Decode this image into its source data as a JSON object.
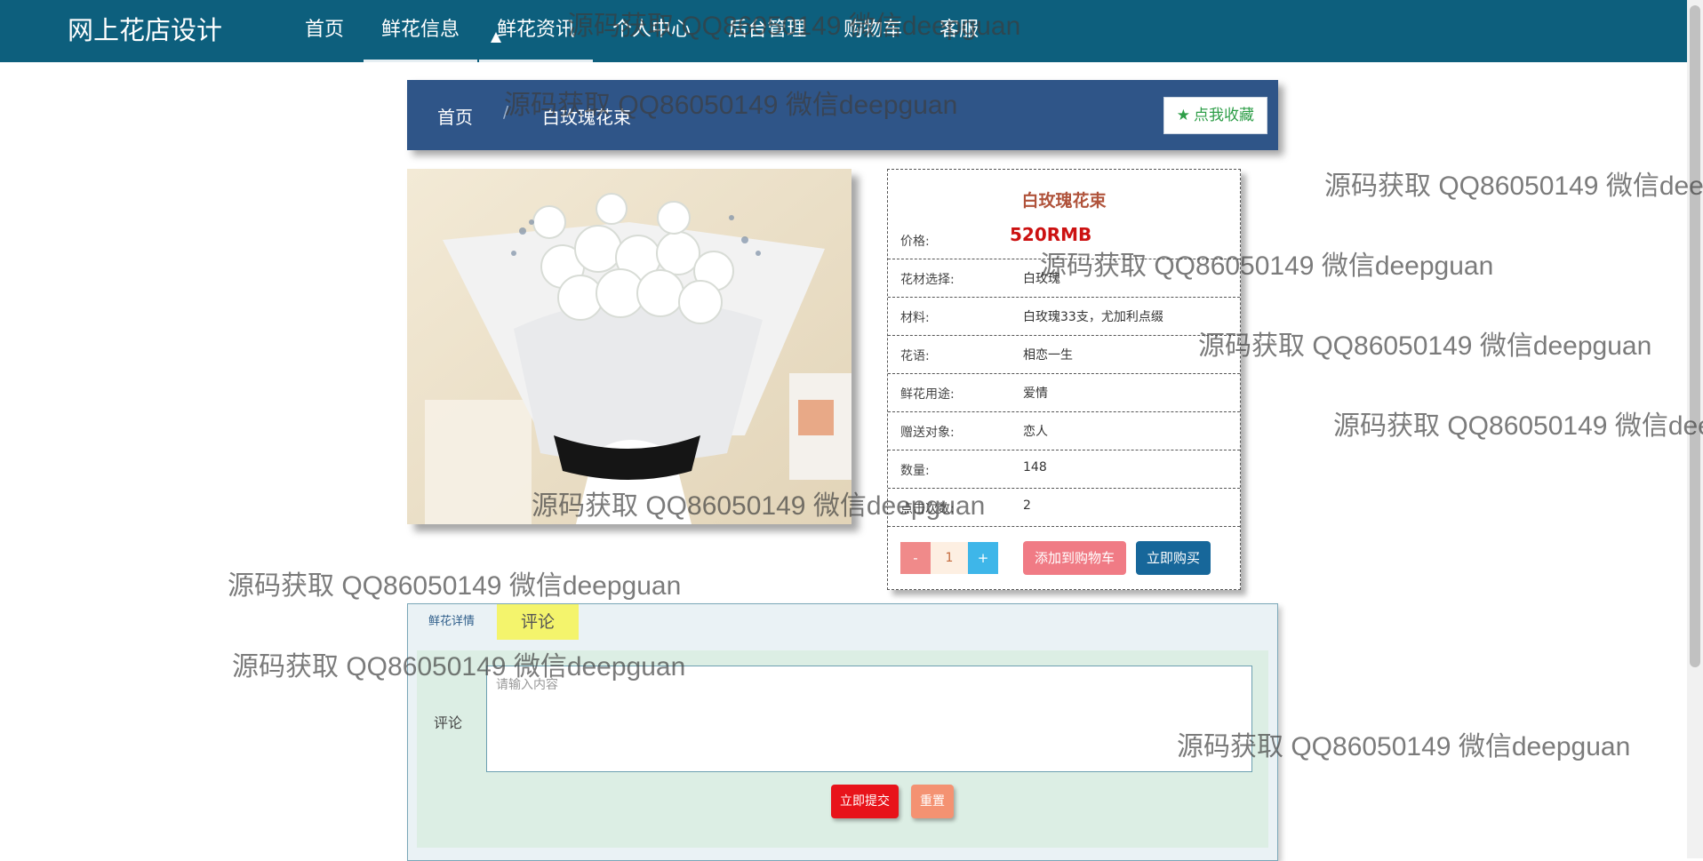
{
  "brand": "网上花店设计",
  "nav": {
    "items": [
      "首页",
      "鲜花信息",
      "鲜花资讯",
      "个人中心",
      "后台管理",
      "购物车",
      "客服"
    ]
  },
  "breadcrumb": {
    "home": "首页",
    "separator": "/",
    "current": "白玫瑰花束"
  },
  "favorite_label": "点我收藏",
  "product": {
    "title": "白玫瑰花束",
    "price_label": "价格:",
    "price_value": "520RMB",
    "rows": [
      {
        "label": "花材选择:",
        "value": "白玫瑰"
      },
      {
        "label": "材料:",
        "value": "白玫瑰33支，尤加利点缀"
      },
      {
        "label": "花语:",
        "value": "相恋一生"
      },
      {
        "label": "鲜花用途:",
        "value": "爱情"
      },
      {
        "label": "赠送对象:",
        "value": "恋人"
      },
      {
        "label": "数量:",
        "value": "148"
      },
      {
        "label": "点击次数:",
        "value": "2"
      }
    ],
    "qty_minus": "-",
    "qty_value": "1",
    "qty_plus": "+",
    "add_to_cart": "添加到购物车",
    "buy_now": "立即购买"
  },
  "tabs": {
    "detail": "鲜花详情",
    "comments": "评论"
  },
  "comment_form": {
    "label": "评论",
    "placeholder": "请输入内容",
    "submit": "立即提交",
    "reset": "重置"
  },
  "watermark": "源码获取 QQ86050149 微信deepguan",
  "colors": {
    "nav_bg": "#0d5f7d",
    "breadcrumb_bg": "#2f5588",
    "price": "#cc1111",
    "title": "#b0533b",
    "submit": "#e8131a",
    "buy": "#17679a",
    "cart": "#f07b85",
    "tab_active": "#f4f46c"
  }
}
